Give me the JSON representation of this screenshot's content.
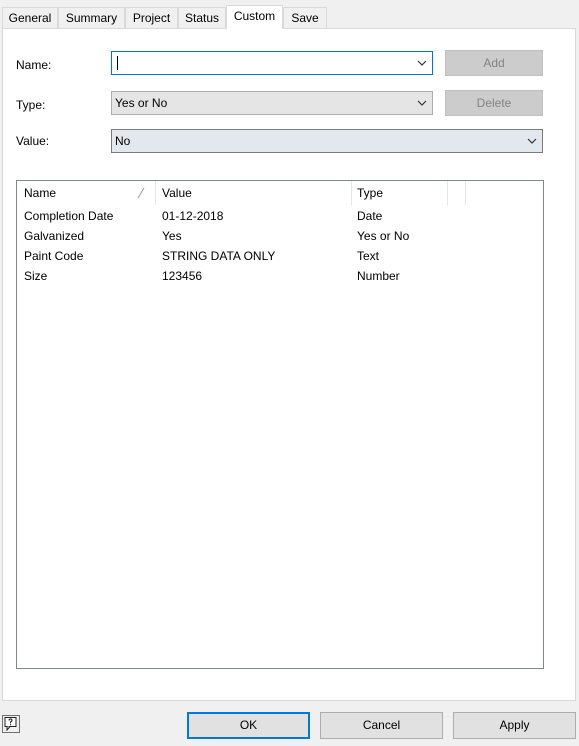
{
  "tabs": [
    "General",
    "Summary",
    "Project",
    "Status",
    "Custom",
    "Save"
  ],
  "active_tab": "Custom",
  "form": {
    "name_label": "Name:",
    "name_value": "",
    "type_label": "Type:",
    "type_value": "Yes or No",
    "value_label": "Value:",
    "value_value": "No",
    "add_label": "Add",
    "delete_label": "Delete"
  },
  "properties_list": {
    "columns": [
      "Name",
      "Value",
      "Type"
    ],
    "rows": [
      {
        "name": "Completion Date",
        "value": "01-12-2018",
        "type": "Date"
      },
      {
        "name": "Galvanized",
        "value": "Yes",
        "type": "Yes or No"
      },
      {
        "name": "Paint Code",
        "value": "STRING DATA ONLY",
        "type": "Text"
      },
      {
        "name": "Size",
        "value": "123456",
        "type": "Number"
      }
    ]
  },
  "footer": {
    "help_icon": "help-question-icon",
    "ok_label": "OK",
    "cancel_label": "Cancel",
    "apply_label": "Apply"
  },
  "colors": {
    "focus_border": "#0078d7",
    "disabled_text": "#838383",
    "dialog_bg": "#f0f0f0"
  }
}
